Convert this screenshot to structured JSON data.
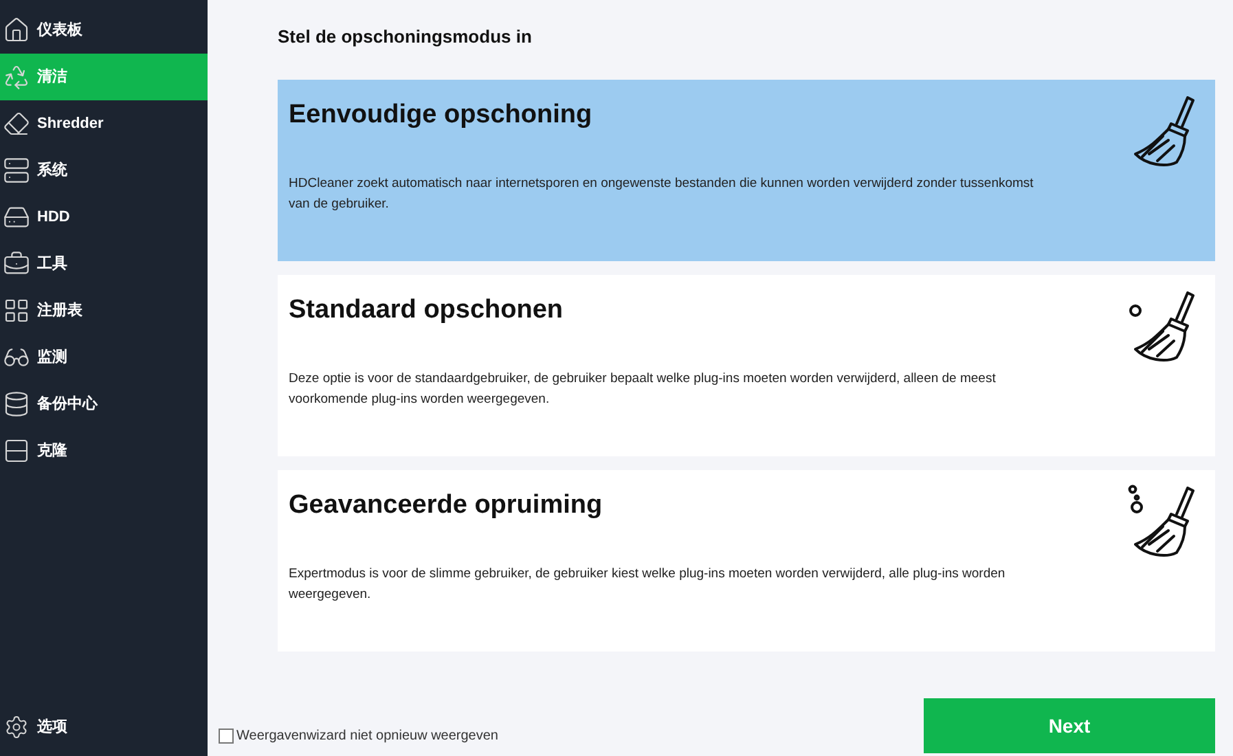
{
  "sidebar": {
    "items": [
      {
        "label": "仪表板",
        "selected": false
      },
      {
        "label": "清洁",
        "selected": true
      },
      {
        "label": "Shredder",
        "selected": false
      },
      {
        "label": "系统",
        "selected": false
      },
      {
        "label": "HDD",
        "selected": false
      },
      {
        "label": "工具",
        "selected": false
      },
      {
        "label": "注册表",
        "selected": false
      },
      {
        "label": "监测",
        "selected": false
      },
      {
        "label": "备份中心",
        "selected": false
      },
      {
        "label": "克隆",
        "selected": false
      }
    ],
    "footer": {
      "label": "选项"
    }
  },
  "heading": "Stel de opschoningsmodus in",
  "modes": [
    {
      "title": "Eenvoudige opschoning",
      "description": "HDCleaner zoekt automatisch naar internetsporen en ongewenste bestanden die kunnen worden verwijderd zonder tussenkomst van de gebruiker.",
      "kind": "plain",
      "selected": true
    },
    {
      "title": "Standaard opschonen",
      "description": "Deze optie is voor de standaardgebruiker, de gebruiker bepaalt welke plug-ins moeten worden verwijderd, alleen de meest voorkomende plug-ins worden weergegeven.",
      "kind": "one-bubble",
      "selected": false
    },
    {
      "title": "Geavanceerde opruiming",
      "description": "Expertmodus is voor de slimme gebruiker, de gebruiker kiest welke plug-ins moeten worden verwijderd, alle plug-ins worden weergegeven.",
      "kind": "bubbles",
      "selected": false
    }
  ],
  "dont_show_again": {
    "label": "Weergavenwizard niet opnieuw weergeven",
    "checked": false
  },
  "next_button": "Next"
}
